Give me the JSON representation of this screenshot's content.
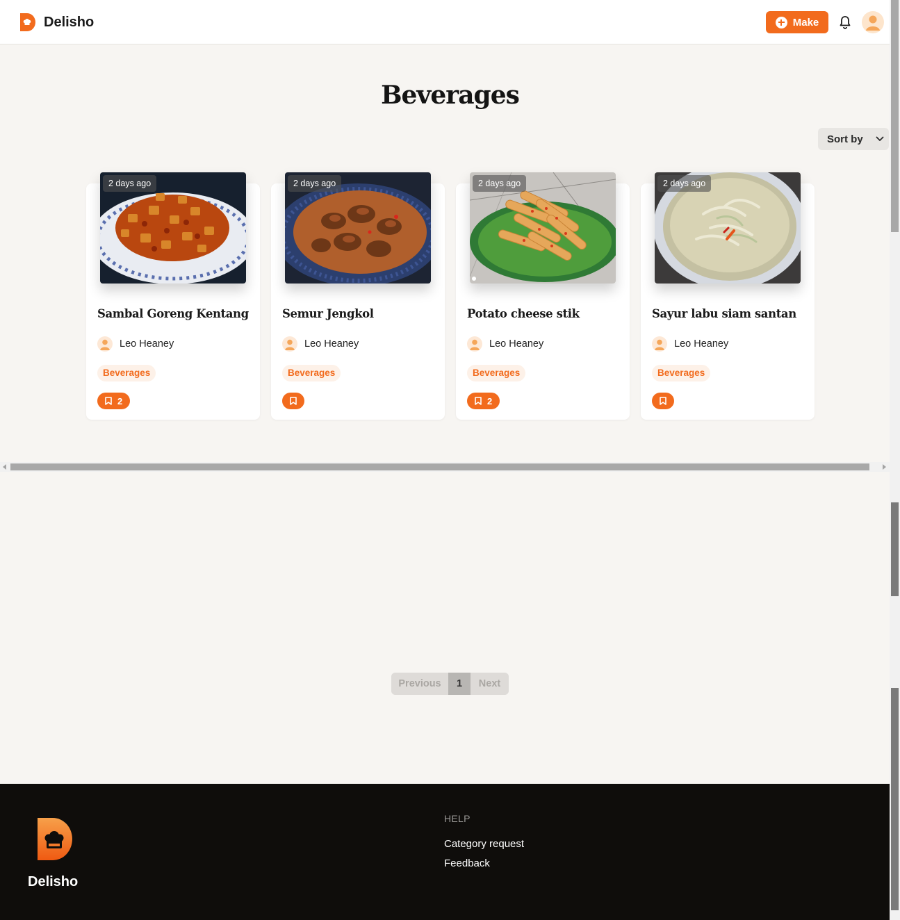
{
  "header": {
    "brand": "Delisho",
    "make_label": "Make"
  },
  "page": {
    "title": "Beverages"
  },
  "sort": {
    "label": "Sort by"
  },
  "recipes": [
    {
      "title": "Sambal Goreng Kentang",
      "time": "2 days ago",
      "author": "Leo Heaney",
      "category": "Beverages",
      "saves": "2"
    },
    {
      "title": "Semur Jengkol",
      "time": "2 days ago",
      "author": "Leo Heaney",
      "category": "Beverages",
      "saves": ""
    },
    {
      "title": "Potato cheese stik",
      "time": "2 days ago",
      "author": "Leo Heaney",
      "category": "Beverages",
      "saves": "2"
    },
    {
      "title": "Sayur labu siam santan",
      "time": "2 days ago",
      "author": "Leo Heaney",
      "category": "Beverages",
      "saves": ""
    }
  ],
  "pagination": {
    "previous": "Previous",
    "current": "1",
    "next": "Next"
  },
  "footer": {
    "brand": "Delisho",
    "help_heading": "HELP",
    "links": [
      "Category request",
      "Feedback"
    ]
  },
  "colors": {
    "accent": "#f26b1d",
    "background": "#f7f5f2",
    "footer": "#0f0d0b"
  },
  "icons": [
    "logo-icon",
    "plus-circle-icon",
    "bell-icon",
    "avatar",
    "chevron-down-icon",
    "bookmark-icon"
  ]
}
